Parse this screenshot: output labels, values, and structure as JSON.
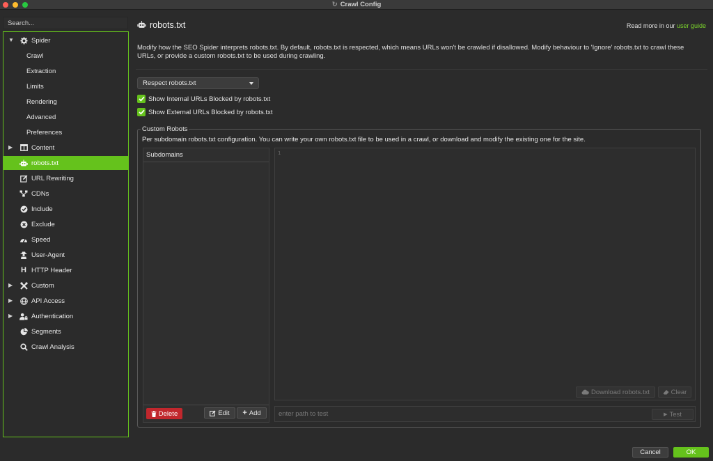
{
  "window": {
    "title": "Crawl Config"
  },
  "sidebar": {
    "search_placeholder": "Search...",
    "items": [
      {
        "label": "Spider",
        "icon": "gear-icon",
        "caret": "down"
      },
      {
        "label": "Crawl"
      },
      {
        "label": "Extraction"
      },
      {
        "label": "Limits"
      },
      {
        "label": "Rendering"
      },
      {
        "label": "Advanced"
      },
      {
        "label": "Preferences"
      },
      {
        "label": "Content",
        "icon": "columns-icon",
        "caret": "right"
      },
      {
        "label": "robots.txt",
        "icon": "robot-icon",
        "selected": true
      },
      {
        "label": "URL Rewriting",
        "icon": "edit-icon"
      },
      {
        "label": "CDNs",
        "icon": "sitemap-icon"
      },
      {
        "label": "Include",
        "icon": "check-circle-icon"
      },
      {
        "label": "Exclude",
        "icon": "x-circle-icon"
      },
      {
        "label": "Speed",
        "icon": "gauge-icon"
      },
      {
        "label": "User-Agent",
        "icon": "user-secret-icon"
      },
      {
        "label": "HTTP Header",
        "icon": "h-icon"
      },
      {
        "label": "Custom",
        "icon": "tools-icon",
        "caret": "right"
      },
      {
        "label": "API Access",
        "icon": "globe-icon",
        "caret": "right"
      },
      {
        "label": "Authentication",
        "icon": "users-lock-icon",
        "caret": "right"
      },
      {
        "label": "Segments",
        "icon": "pie-icon"
      },
      {
        "label": "Crawl Analysis",
        "icon": "search-icon"
      }
    ]
  },
  "main": {
    "title": "robots.txt",
    "read_more_prefix": "Read more in our",
    "read_more_link": "user guide",
    "description": "Modify how the SEO Spider interprets robots.txt. By default, robots.txt is respected, which means URLs won't be crawled if disallowed. Modify behaviour to 'Ignore' robots.txt to crawl these URLs, or provide a custom robots.txt to be used during crawling.",
    "mode_select": "Respect robots.txt",
    "checkbox_internal": "Show Internal URLs Blocked by robots.txt",
    "checkbox_external": "Show External URLs Blocked by robots.txt",
    "custom_robots": {
      "title": "Custom Robots",
      "description": "Per subdomain robots.txt configuration. You can write your own robots.txt file to be used in a crawl, or download and modify the existing one for the site.",
      "subdomains_header": "Subdomains",
      "delete_label": "Delete",
      "edit_label": "Edit",
      "add_label": "Add",
      "line_number": "1",
      "download_label": "Download robots.txt",
      "clear_label": "Clear",
      "test_placeholder": "enter path to test",
      "test_label": "Test"
    }
  },
  "footer": {
    "cancel_label": "Cancel",
    "ok_label": "OK"
  },
  "colors": {
    "accent": "#65c21c",
    "danger": "#c1272d",
    "background": "#2b2b2b"
  }
}
